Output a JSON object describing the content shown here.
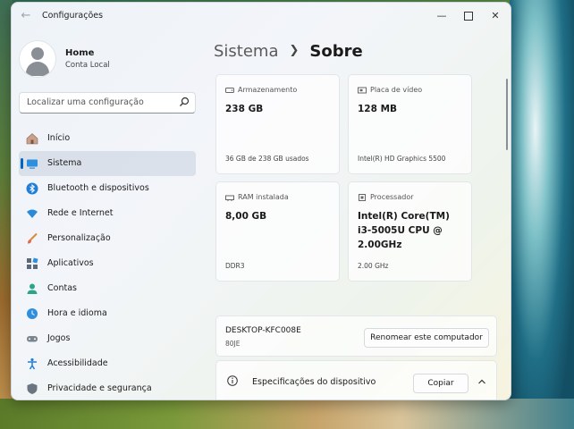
{
  "window": {
    "title": "Configurações"
  },
  "profile": {
    "name": "Home",
    "account_type": "Conta Local"
  },
  "search": {
    "placeholder": "Localizar uma configuração"
  },
  "nav": {
    "items": [
      {
        "label": "Início",
        "icon": "home-icon"
      },
      {
        "label": "Sistema",
        "icon": "system-icon",
        "selected": true
      },
      {
        "label": "Bluetooth e dispositivos",
        "icon": "bluetooth-icon"
      },
      {
        "label": "Rede e Internet",
        "icon": "wifi-icon"
      },
      {
        "label": "Personalização",
        "icon": "brush-icon"
      },
      {
        "label": "Aplicativos",
        "icon": "apps-icon"
      },
      {
        "label": "Contas",
        "icon": "person-icon"
      },
      {
        "label": "Hora e idioma",
        "icon": "globe-clock-icon"
      },
      {
        "label": "Jogos",
        "icon": "gamepad-icon"
      },
      {
        "label": "Acessibilidade",
        "icon": "accessibility-icon"
      },
      {
        "label": "Privacidade e segurança",
        "icon": "shield-icon"
      }
    ]
  },
  "breadcrumb": {
    "parent": "Sistema",
    "current": "Sobre"
  },
  "cards": {
    "storage": {
      "label": "Armazenamento",
      "value": "238 GB",
      "sub": "36 GB de 238 GB usados"
    },
    "gpu": {
      "label": "Placa de vídeo",
      "value": "128 MB",
      "sub": "Intel(R) HD Graphics 5500"
    },
    "ram": {
      "label": "RAM instalada",
      "value": "8,00 GB",
      "sub": "DDR3"
    },
    "cpu": {
      "label": "Processador",
      "value": "Intel(R) Core(TM) i3-5005U CPU @ 2.00GHz",
      "sub": "2.00 GHz"
    }
  },
  "device": {
    "name": "DESKTOP-KFC008E",
    "model": "80JE",
    "rename_label": "Renomear este computador"
  },
  "specs": {
    "label": "Especificações do dispositivo",
    "copy_label": "Copiar"
  },
  "colors": {
    "accent": "#0067c0"
  }
}
